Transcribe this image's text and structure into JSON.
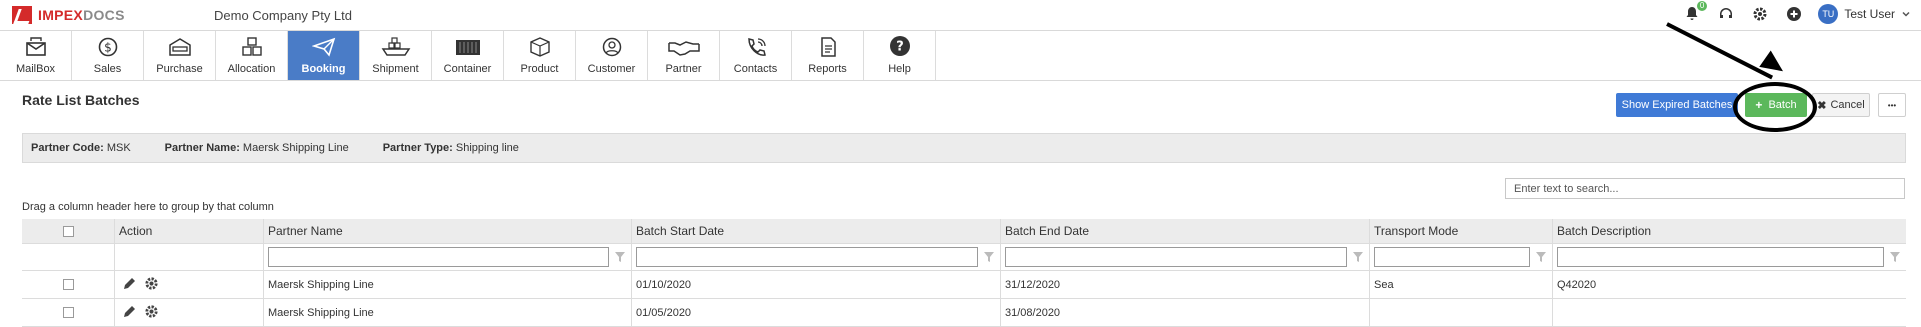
{
  "app": {
    "logo_part1": "IMPEX",
    "logo_part2": "DOCS",
    "company": "Demo Company Pty Ltd",
    "notification_count": "0",
    "user_initials": "TU",
    "user_name": "Test User"
  },
  "modules": [
    {
      "label": "MailBox",
      "icon": "mailbox-icon"
    },
    {
      "label": "Sales",
      "icon": "dollar-icon"
    },
    {
      "label": "Purchase",
      "icon": "purchase-icon"
    },
    {
      "label": "Allocation",
      "icon": "boxes-icon"
    },
    {
      "label": "Booking",
      "icon": "paper-plane-icon",
      "active": true
    },
    {
      "label": "Shipment",
      "icon": "ship-icon"
    },
    {
      "label": "Container",
      "icon": "container-icon"
    },
    {
      "label": "Product",
      "icon": "product-box-icon"
    },
    {
      "label": "Customer",
      "icon": "customer-icon"
    },
    {
      "label": "Partner",
      "icon": "handshake-icon"
    },
    {
      "label": "Contacts",
      "icon": "phone-icon"
    },
    {
      "label": "Reports",
      "icon": "report-icon"
    },
    {
      "label": "Help",
      "icon": "help-icon"
    }
  ],
  "page": {
    "title": "Rate List Batches",
    "show_expired_label": "Show Expired Batches",
    "batch_label": "Batch",
    "cancel_label": "Cancel",
    "more_label": "•••"
  },
  "partner": {
    "code_label": "Partner Code:",
    "code": "MSK",
    "name_label": "Partner Name:",
    "name": "Maersk Shipping Line",
    "type_label": "Partner Type:",
    "type": "Shipping line"
  },
  "grid": {
    "group_hint": "Drag a column header here to group by that column",
    "search_placeholder": "Enter text to search...",
    "columns": [
      "Action",
      "Partner Name",
      "Batch Start Date",
      "Batch End Date",
      "Transport Mode",
      "Batch Description"
    ],
    "rows": [
      {
        "partner": "Maersk Shipping Line",
        "start": "01/10/2020",
        "end": "31/12/2020",
        "mode": "Sea",
        "desc": "Q42020"
      },
      {
        "partner": "Maersk Shipping Line",
        "start": "01/05/2020",
        "end": "31/08/2020",
        "mode": "",
        "desc": ""
      }
    ]
  },
  "colors": {
    "accent": "#4a7cc7",
    "batch_green": "#5cb85c",
    "brand_red": "#d42a2a"
  }
}
